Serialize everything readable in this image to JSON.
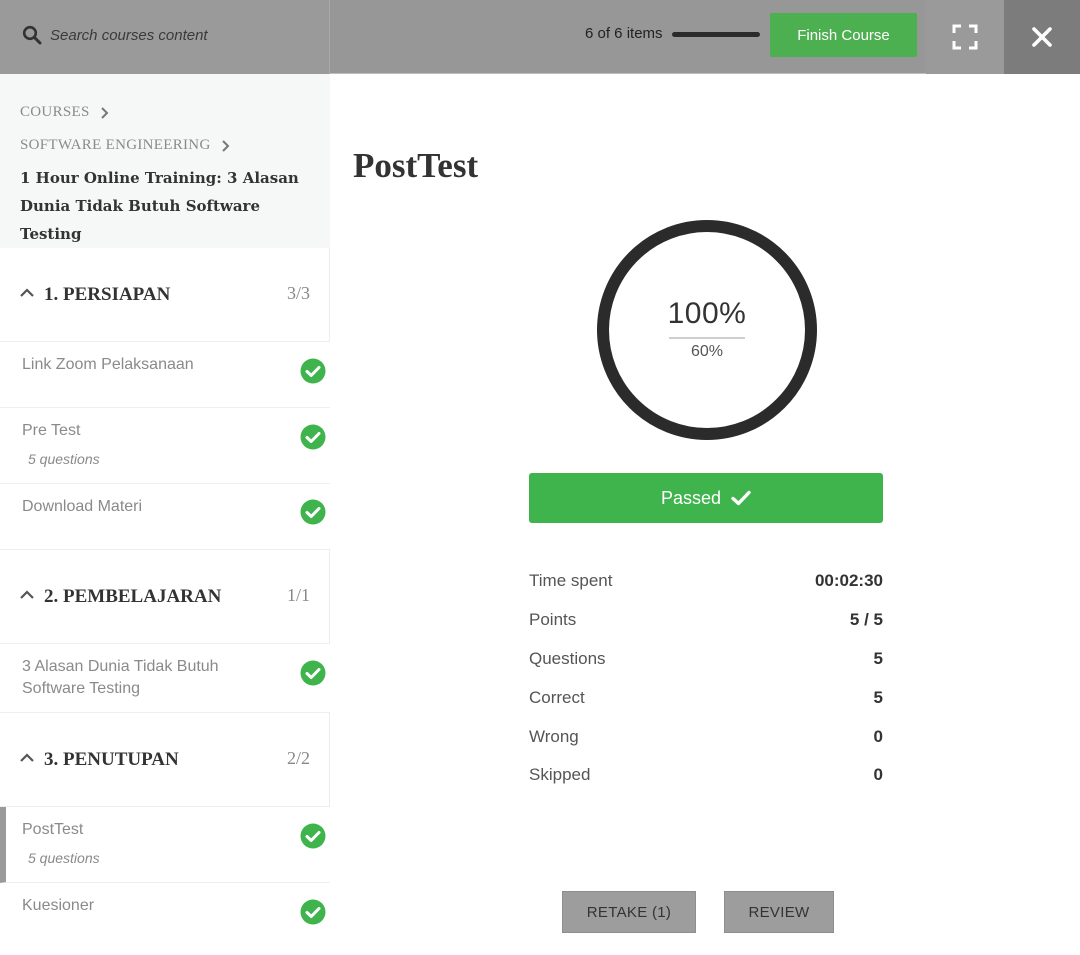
{
  "header": {
    "search_placeholder": "Search courses content",
    "items_count": "6 of 6 items",
    "progress": 1.0,
    "finish_label": "Finish Course"
  },
  "sidebar": {
    "breadcrumbs": [
      "COURSES",
      "SOFTWARE ENGINEERING"
    ],
    "course_title_line1": "1 Hour Online Training: 3 Alasan",
    "course_title_line2": "Dunia Tidak Butuh Software Testing",
    "sections": [
      {
        "title": "1. PERSIAPAN",
        "count": "3/3",
        "lessons": [
          {
            "title": "Link Zoom Pelaksanaan",
            "subtitle": ""
          },
          {
            "title": "Pre Test",
            "subtitle": "5 questions"
          },
          {
            "title": "Download Materi",
            "subtitle": ""
          }
        ]
      },
      {
        "title": "2. PEMBELAJARAN",
        "count": "1/1",
        "lessons": [
          {
            "title_line1": "3 Alasan Dunia Tidak Butuh",
            "title_line2": "Software Testing"
          }
        ]
      },
      {
        "title": "3. PENUTUPAN",
        "count": "2/2",
        "lessons": [
          {
            "title": "PostTest",
            "subtitle": "5 questions"
          },
          {
            "title": "Kuesioner",
            "subtitle": ""
          }
        ]
      }
    ]
  },
  "main": {
    "title": "PostTest",
    "score": "100%",
    "passing_grade": "60%",
    "result_label": "Passed",
    "stats": [
      {
        "label": "Time spent",
        "value": "00:02:30"
      },
      {
        "label": "Points",
        "value": "5 / 5"
      },
      {
        "label": "Questions",
        "value": "5"
      },
      {
        "label": "Correct",
        "value": "5"
      },
      {
        "label": "Wrong",
        "value": "0"
      },
      {
        "label": "Skipped",
        "value": "0"
      }
    ],
    "retake_label": "RETAKE (1)",
    "review_label": "REVIEW"
  },
  "colors": {
    "accent_green": "#4caf50",
    "check_green": "#3fb44d",
    "topbar_gray": "#979797"
  },
  "icons": {
    "search": "search-icon",
    "fullscreen": "fullscreen-icon",
    "close": "close-icon",
    "check": "check-circle-icon",
    "caret": "chevron-up-icon",
    "crumb_chevron": "chevron-right-icon"
  }
}
